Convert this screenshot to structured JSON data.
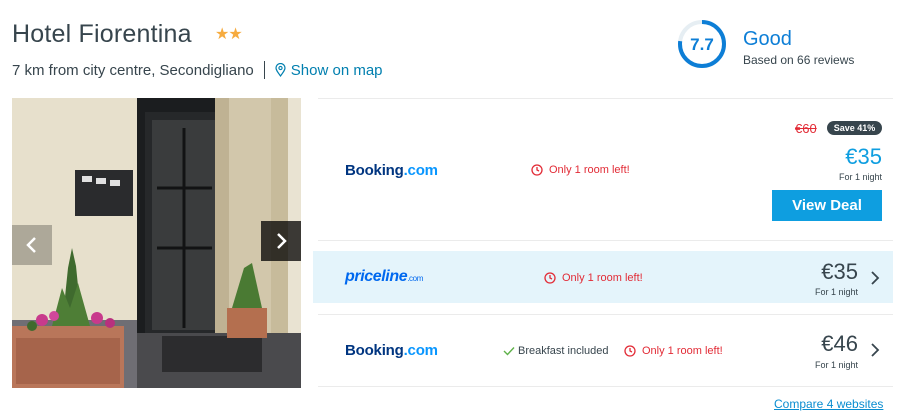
{
  "hotel": {
    "name": "Hotel Fiorentina",
    "stars": "★★",
    "distance": "7 km from city centre, Secondigliano",
    "map_link": "Show on map"
  },
  "rating": {
    "score": "7.7",
    "score_fraction": 0.77,
    "word": "Good",
    "reviews": "Based on 66 reviews"
  },
  "gallery": {
    "prev_icon": "chevron-left-icon",
    "next_icon": "chevron-right-icon"
  },
  "deals": [
    {
      "provider_main": "Booking",
      "provider_dot": ".com",
      "availability": "Only 1 room left!",
      "old_price": "€60",
      "save_badge": "Save 41%",
      "price": "€35",
      "price_note": "For 1 night",
      "button": "View Deal"
    },
    {
      "provider_main": "priceline",
      "provider_dot": ".com",
      "availability": "Only 1 room left!",
      "price": "€35",
      "price_note": "For 1 night"
    },
    {
      "provider_main": "Booking",
      "provider_dot": ".com",
      "breakfast": "Breakfast included",
      "availability": "Only 1 room left!",
      "price": "€46",
      "price_note": "For 1 night"
    }
  ],
  "compare_link": "Compare 4 websites",
  "colors": {
    "accent": "#0d7ed6",
    "button": "#0e9ee0",
    "alert": "#e22b36",
    "highlight_row": "#e4f4fb",
    "star": "#f6ab3f"
  }
}
